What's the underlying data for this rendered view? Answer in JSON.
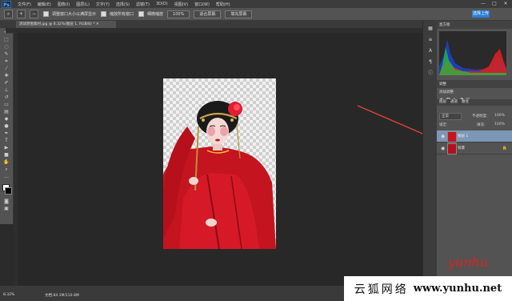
{
  "menubar": {
    "logo": "Ps",
    "items": [
      "文件(F)",
      "编辑(E)",
      "图像(I)",
      "图层(L)",
      "文字(Y)",
      "选择(S)",
      "滤镜(T)",
      "3D(D)",
      "视图(V)",
      "窗口(W)",
      "帮助(H)"
    ],
    "window_controls": [
      "—",
      "□",
      "✕"
    ]
  },
  "options": {
    "checkbox1_label": "调整窗口大小以满屏显示",
    "checkbox2_label": "缩放所有窗口",
    "checkbox3_label": "细微缩放",
    "btn_100": "100%",
    "btn_fit": "适合屏幕",
    "btn_fill": "填充屏幕",
    "share_label": "选择上传"
  },
  "tab": {
    "title": "测试原图素材.jpg @ 8.32%(图层 1, RGB/8) * ✕"
  },
  "status": {
    "zoom": "8.32%",
    "doc": "文档:84.1M/110.8M"
  },
  "panels": {
    "histogram_tab": "直方图",
    "adjust_tab": "调整",
    "adjust_title": "添加调整",
    "layers_tabs": [
      "图层",
      "通道",
      "路径"
    ],
    "blend_mode": "正常",
    "opacity_label": "不透明度:",
    "opacity_value": "100%",
    "lock_label": "锁定:",
    "fill_label": "填充:",
    "fill_value": "100%",
    "layers": [
      {
        "name": "图层 1",
        "selected": true
      },
      {
        "name": "背景",
        "selected": false
      }
    ]
  },
  "watermark": {
    "cn": "云狐网络",
    "url": "www.yunhu.net",
    "fox": "yunhu"
  },
  "colors": {
    "accent": "#2d7fd6",
    "arrow": "#e0443a",
    "selected_layer": "#7d97b6"
  }
}
